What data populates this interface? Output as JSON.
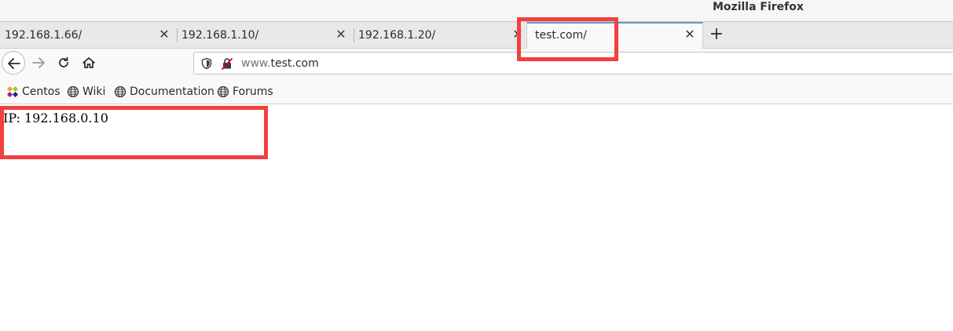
{
  "window": {
    "title": "Mozilla Firefox"
  },
  "tabs": [
    {
      "label": "192.168.1.66/",
      "active": false
    },
    {
      "label": "192.168.1.10/",
      "active": false
    },
    {
      "label": "192.168.1.20/",
      "active": false
    },
    {
      "label": "test.com/",
      "active": true
    }
  ],
  "tab_close_symbol": "✕",
  "new_tab_symbol": "+",
  "urlbar": {
    "prefix": "www.",
    "domain": "test.com"
  },
  "bookmarks": [
    {
      "label": "Centos",
      "icon": "centos-logo-icon"
    },
    {
      "label": "Wiki",
      "icon": "globe-icon"
    },
    {
      "label": "Documentation",
      "icon": "globe-icon"
    },
    {
      "label": "Forums",
      "icon": "globe-icon"
    }
  ],
  "page": {
    "text": "IP: 192.168.0.10"
  },
  "annotation": {
    "highlight_color": "#f04040"
  }
}
